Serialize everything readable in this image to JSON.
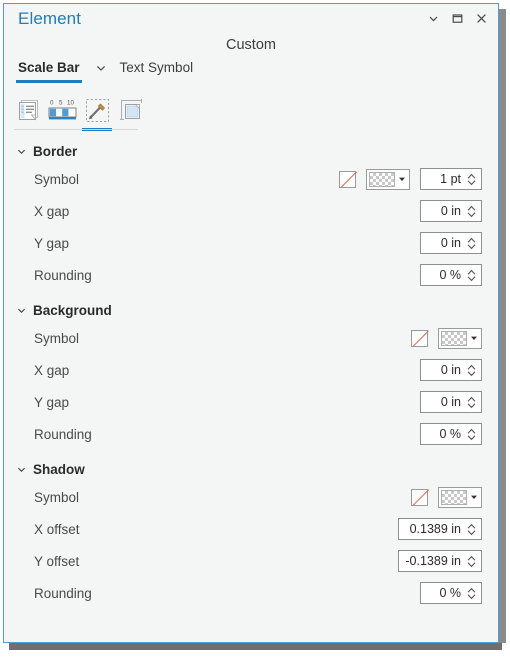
{
  "window": {
    "title": "Element",
    "buttons": [
      {
        "name": "collapse-button",
        "icon": "chevron-down-icon",
        "label": "Collapse"
      },
      {
        "name": "maximize-button",
        "icon": "maximize-icon",
        "label": "Maximize"
      },
      {
        "name": "close-button",
        "icon": "close-icon",
        "label": "Close"
      }
    ]
  },
  "header": {
    "title": "Custom"
  },
  "tabs": {
    "items": [
      {
        "label": "Scale Bar",
        "active": true
      },
      {
        "label": "Text Symbol",
        "active": false
      }
    ],
    "dropdown_icon": "chevron-down-icon"
  },
  "toolbar": {
    "items": [
      {
        "name": "tool-properties",
        "icon": "properties-icon",
        "selected": false
      },
      {
        "name": "tool-scalebar-divisions",
        "icon": "scale-bar-icon",
        "selected": false,
        "ticks": [
          "0",
          "5",
          "10"
        ]
      },
      {
        "name": "tool-symbology",
        "icon": "paintbrush-icon",
        "selected": true
      },
      {
        "name": "tool-display",
        "icon": "page-layout-icon",
        "selected": false
      }
    ]
  },
  "sections": [
    {
      "name": "border",
      "title": "Border",
      "expanded": true,
      "rows": [
        {
          "name": "border-symbol",
          "label": "Symbol",
          "type": "symbol",
          "has_nocolor": true,
          "has_swatch": true,
          "spinner": {
            "value": "1 pt",
            "width": "narrow"
          }
        },
        {
          "name": "border-x-gap",
          "label": "X gap",
          "type": "spinner",
          "spinner": {
            "value": "0 in",
            "width": "narrow"
          }
        },
        {
          "name": "border-y-gap",
          "label": "Y gap",
          "type": "spinner",
          "spinner": {
            "value": "0 in",
            "width": "narrow"
          }
        },
        {
          "name": "border-rounding",
          "label": "Rounding",
          "type": "spinner",
          "spinner": {
            "value": "0 %",
            "width": "narrow"
          }
        }
      ]
    },
    {
      "name": "background",
      "title": "Background",
      "expanded": true,
      "rows": [
        {
          "name": "background-symbol",
          "label": "Symbol",
          "type": "symbol",
          "has_nocolor": true,
          "has_swatch": true,
          "spinner": null
        },
        {
          "name": "background-x-gap",
          "label": "X gap",
          "type": "spinner",
          "spinner": {
            "value": "0 in",
            "width": "narrow"
          }
        },
        {
          "name": "background-y-gap",
          "label": "Y gap",
          "type": "spinner",
          "spinner": {
            "value": "0 in",
            "width": "narrow"
          }
        },
        {
          "name": "background-rounding",
          "label": "Rounding",
          "type": "spinner",
          "spinner": {
            "value": "0 %",
            "width": "narrow"
          }
        }
      ]
    },
    {
      "name": "shadow",
      "title": "Shadow",
      "expanded": true,
      "rows": [
        {
          "name": "shadow-symbol",
          "label": "Symbol",
          "type": "symbol",
          "has_nocolor": true,
          "has_swatch": true,
          "spinner": null
        },
        {
          "name": "shadow-x-offset",
          "label": "X offset",
          "type": "spinner",
          "spinner": {
            "value": "0.1389 in",
            "width": "wide"
          }
        },
        {
          "name": "shadow-y-offset",
          "label": "Y offset",
          "type": "spinner",
          "spinner": {
            "value": "-0.1389 in",
            "width": "wide"
          }
        },
        {
          "name": "shadow-rounding",
          "label": "Rounding",
          "type": "spinner",
          "spinner": {
            "value": "0 %",
            "width": "narrow"
          }
        }
      ]
    }
  ],
  "colors": {
    "accent": "#1c7ec1",
    "panel_bg": "#f4f6f6",
    "border": "#4b9fd5",
    "nocolor_slash": "#e06a4a",
    "text": "#4a4a4a"
  }
}
